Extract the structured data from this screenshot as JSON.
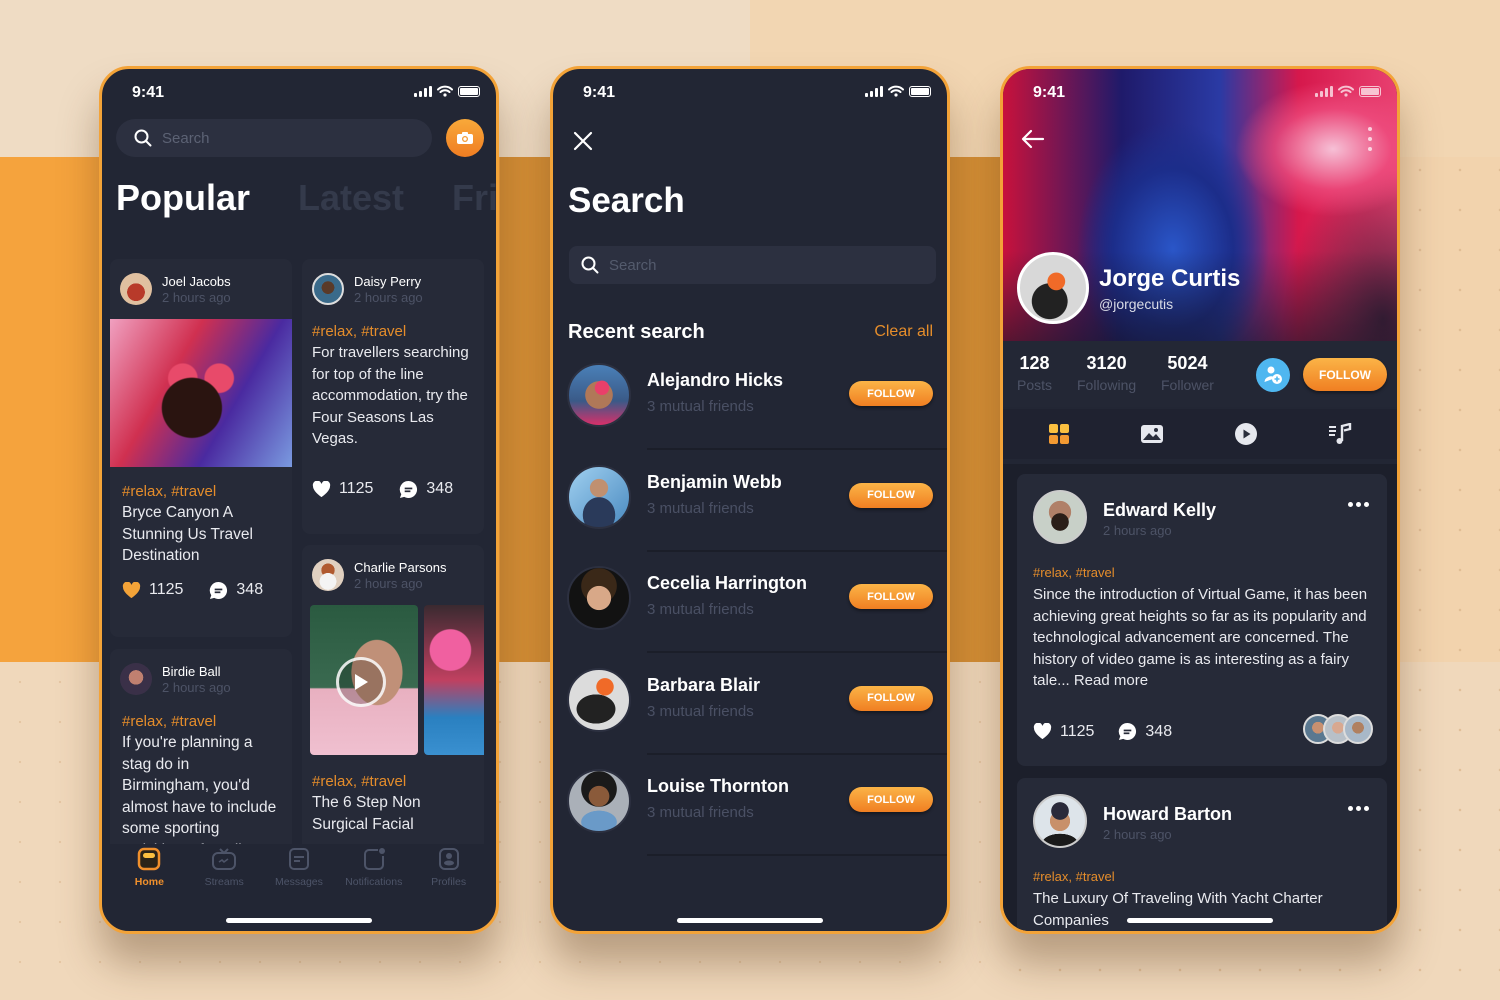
{
  "colors": {
    "accent": "#f39a32",
    "background_dark": "#222634",
    "card": "#262a38",
    "tag": "#e58d2b",
    "add_friend": "#4fb7f0"
  },
  "status_bar": {
    "time": "9:41"
  },
  "home_screen": {
    "search_placeholder": "Search",
    "camera_icon": "camera-icon",
    "tabs": [
      {
        "label": "Popular",
        "active": true
      },
      {
        "label": "Latest",
        "active": false
      },
      {
        "label": "Friends",
        "active": false
      }
    ],
    "posts": [
      {
        "author": "Joel Jacobs",
        "time": "2 hours ago",
        "tags": "#relax, #travel",
        "text": "Bryce Canyon A Stunning Us Travel Destination",
        "likes": "1125",
        "comments": "348",
        "liked": true,
        "has_image": true
      },
      {
        "author": "Daisy Perry",
        "time": "2 hours ago",
        "tags": "#relax, #travel",
        "text": "For travellers searching for top of the line accommodation, try the Four Seasons Las Vegas.",
        "likes": "1125",
        "comments": "348",
        "liked": false
      },
      {
        "author": "Charlie Parsons",
        "time": "2 hours ago",
        "tags": "#relax, #travel",
        "text": "The 6 Step Non Surgical Facial",
        "has_video": true
      },
      {
        "author": "Birdie Ball",
        "time": "2 hours ago",
        "tags": "#relax, #travel",
        "text": "If you're planning a stag do in Birmingham, you'd almost have to include some sporting activities. After all,"
      }
    ],
    "bottom_nav": [
      {
        "label": "Home",
        "icon": "home-icon",
        "active": true
      },
      {
        "label": "Streams",
        "icon": "tv-icon",
        "active": false
      },
      {
        "label": "Messages",
        "icon": "message-icon",
        "active": false
      },
      {
        "label": "Notifications",
        "icon": "bell-icon",
        "active": false
      },
      {
        "label": "Profiles",
        "icon": "profile-icon",
        "active": false
      }
    ]
  },
  "search_screen": {
    "title": "Search",
    "search_placeholder": "Search",
    "recent_heading": "Recent search",
    "clear_all": "Clear all",
    "people": [
      {
        "name": "Alejandro Hicks",
        "mutual": "3 mutual friends",
        "button": "FOLLOW"
      },
      {
        "name": "Benjamin Webb",
        "mutual": "3 mutual friends",
        "button": "FOLLOW"
      },
      {
        "name": "Cecelia Harrington",
        "mutual": "3 mutual friends",
        "button": "FOLLOW"
      },
      {
        "name": "Barbara Blair",
        "mutual": "3 mutual friends",
        "button": "FOLLOW"
      },
      {
        "name": "Louise Thornton",
        "mutual": "3 mutual friends",
        "button": "FOLLOW"
      }
    ]
  },
  "profile_screen": {
    "name": "Jorge Curtis",
    "handle": "@jorgecutis",
    "stats": [
      {
        "value": "128",
        "label": "Posts"
      },
      {
        "value": "3120",
        "label": "Following"
      },
      {
        "value": "5024",
        "label": "Follower"
      }
    ],
    "follow_button": "FOLLOW",
    "media_tabs": [
      "grid-icon",
      "image-icon",
      "play-icon",
      "music-icon"
    ],
    "posts": [
      {
        "author": "Edward Kelly",
        "time": "2 hours ago",
        "tags": "#relax, #travel",
        "text": "Since the introduction of Virtual Game, it has been achieving great heights so far as its popularity and technological advancement are concerned. The history of video game is as interesting as a fairy tale... Read more",
        "likes": "1125",
        "comments": "348"
      },
      {
        "author": "Howard Barton",
        "time": "2 hours ago",
        "tags": "#relax, #travel",
        "text": "The Luxury Of Traveling With Yacht Charter Companies"
      }
    ]
  }
}
